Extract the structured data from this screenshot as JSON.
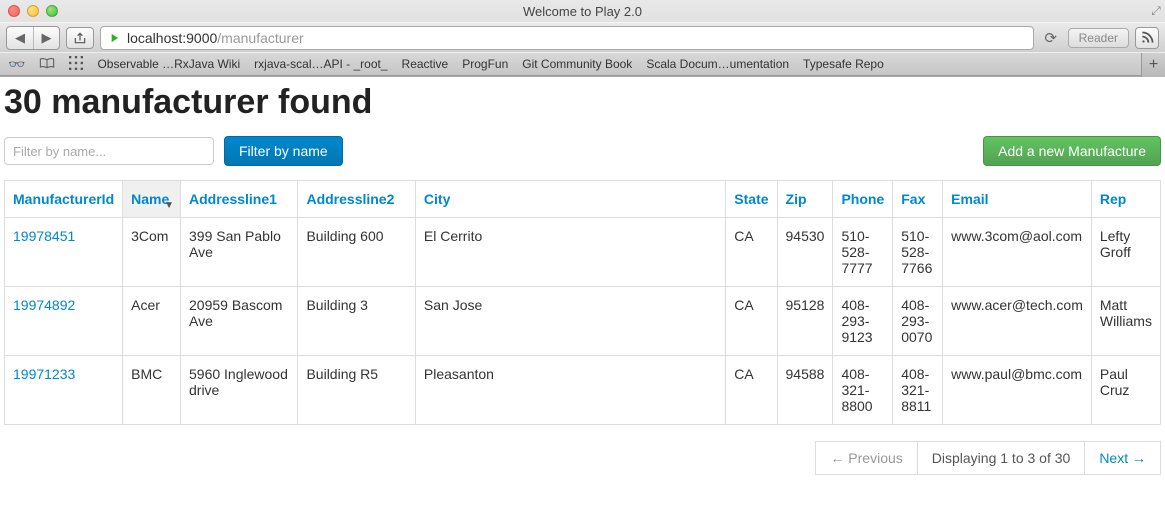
{
  "browser": {
    "window_title": "Welcome to Play 2.0",
    "url_host": "localhost:9000",
    "url_path": "/manufacturer",
    "reader_label": "Reader",
    "bookmarks": [
      "Observable …RxJava Wiki",
      "rxjava-scal…API - _root_",
      "Reactive",
      "ProgFun",
      "Git Community Book",
      "Scala Docum…umentation",
      "Typesafe Repo"
    ]
  },
  "page": {
    "heading": "30 manufacturer found",
    "filter_placeholder": "Filter by name...",
    "filter_button": "Filter by name",
    "add_button": "Add a new Manufacture"
  },
  "table": {
    "headers": {
      "id": "ManufacturerId",
      "name": "Name",
      "addr1": "Addressline1",
      "addr2": "Addressline2",
      "city": "City",
      "state": "State",
      "zip": "Zip",
      "phone": "Phone",
      "fax": "Fax",
      "email": "Email",
      "rep": "Rep"
    },
    "rows": [
      {
        "id": "19978451",
        "name": "3Com",
        "addr1": "399 San Pablo Ave",
        "addr2": "Building 600",
        "city": "El Cerrito",
        "state": "CA",
        "zip": "94530",
        "phone": "510-528-7777",
        "fax": "510-528-7766",
        "email": "www.3com@aol.com",
        "rep": "Lefty Groff"
      },
      {
        "id": "19974892",
        "name": "Acer",
        "addr1": "20959 Bascom Ave",
        "addr2": "Building 3",
        "city": "San Jose",
        "state": "CA",
        "zip": "95128",
        "phone": "408-293-9123",
        "fax": "408-293-0070",
        "email": "www.acer@tech.com",
        "rep": "Matt Williams"
      },
      {
        "id": "19971233",
        "name": "BMC",
        "addr1": "5960 Inglewood drive",
        "addr2": "Building R5",
        "city": "Pleasanton",
        "state": "CA",
        "zip": "94588",
        "phone": "408-321-8800",
        "fax": "408-321-8811",
        "email": "www.paul@bmc.com",
        "rep": "Paul Cruz"
      }
    ]
  },
  "pager": {
    "prev": "← Previous",
    "status": "Displaying 1 to 3 of 30",
    "next": "Next →"
  }
}
